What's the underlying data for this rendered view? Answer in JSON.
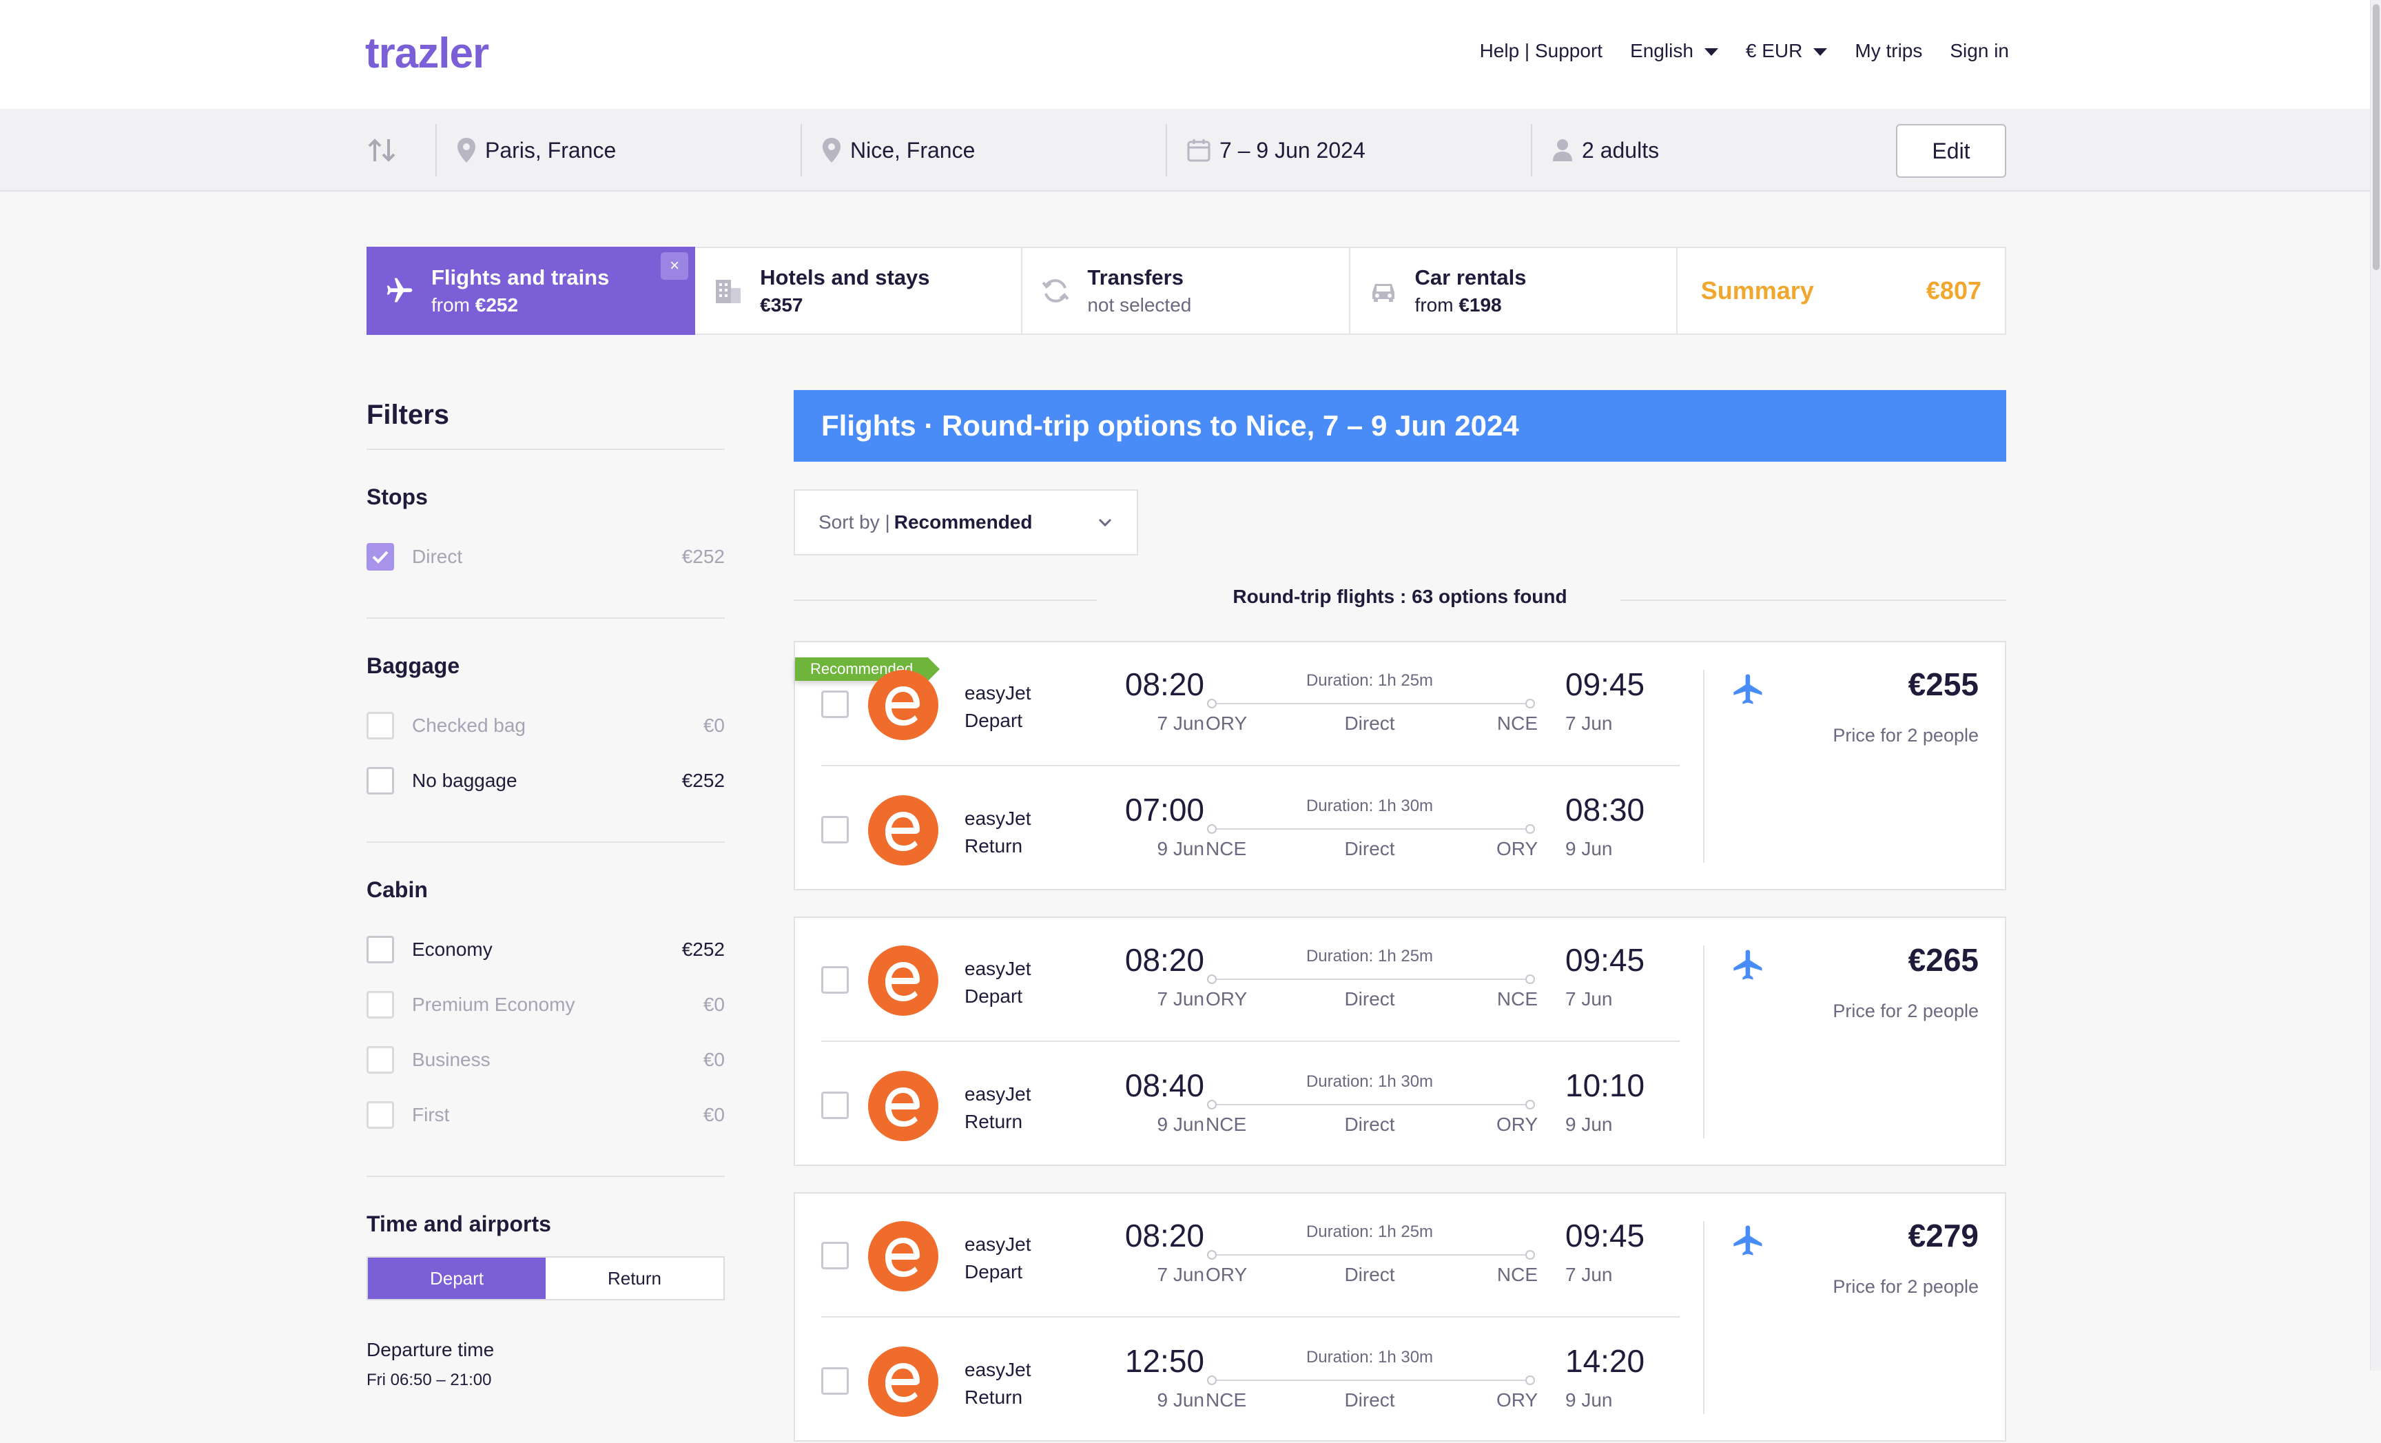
{
  "header": {
    "logo": "trazler",
    "nav": {
      "help": "Help | Support",
      "language": "English",
      "currency": "€ EUR",
      "my_trips": "My trips",
      "sign_in": "Sign in"
    }
  },
  "search": {
    "origin": "Paris, France",
    "destination": "Nice, France",
    "dates": "7 – 9 Jun 2024",
    "travelers": "2 adults",
    "edit": "Edit"
  },
  "tabs": {
    "flights": {
      "title": "Flights and trains",
      "sub_prefix": "from ",
      "sub_value": "€252"
    },
    "hotels": {
      "title": "Hotels and stays",
      "sub_value": "€357"
    },
    "transfers": {
      "title": "Transfers",
      "sub": "not selected"
    },
    "cars": {
      "title": "Car rentals",
      "sub_prefix": "from ",
      "sub_value": "€198"
    },
    "summary": {
      "label": "Summary",
      "value": "€807"
    },
    "close": "×"
  },
  "filters": {
    "title": "Filters",
    "stops": {
      "title": "Stops",
      "items": [
        {
          "label": "Direct",
          "value": "€252"
        }
      ]
    },
    "baggage": {
      "title": "Baggage",
      "items": [
        {
          "label": "Checked bag",
          "value": "€0"
        },
        {
          "label": "No baggage",
          "value": "€252"
        }
      ]
    },
    "cabin": {
      "title": "Cabin",
      "items": [
        {
          "label": "Economy",
          "value": "€252"
        },
        {
          "label": "Premium Economy",
          "value": "€0"
        },
        {
          "label": "Business",
          "value": "€0"
        },
        {
          "label": "First",
          "value": "€0"
        }
      ]
    },
    "time": {
      "title": "Time and airports",
      "depart": "Depart",
      "return": "Return",
      "departure_label": "Departure time",
      "departure_range": "Fri 06:50 – 21:00"
    }
  },
  "results": {
    "banner": "Flights · Round-trip options to Nice, 7 – 9 Jun 2024",
    "sort_prefix": "Sort by |",
    "sort_value": "Recommended",
    "found": "Round-trip flights : 63 options found",
    "recommended_badge": "Recommended",
    "cards": [
      {
        "price": "€255",
        "price_note": "Price for 2 people",
        "depart": {
          "airline": "easyJet",
          "direction": "Depart",
          "dep_time": "08:20",
          "dep_date": "7 Jun",
          "from": "ORY",
          "duration": "Duration: 1h 25m",
          "stops": "Direct",
          "to": "NCE",
          "arr_time": "09:45",
          "arr_date": "7 Jun"
        },
        "return": {
          "airline": "easyJet",
          "direction": "Return",
          "dep_time": "07:00",
          "dep_date": "9 Jun",
          "from": "NCE",
          "duration": "Duration: 1h 30m",
          "stops": "Direct",
          "to": "ORY",
          "arr_time": "08:30",
          "arr_date": "9 Jun"
        }
      },
      {
        "price": "€265",
        "price_note": "Price for 2 people",
        "depart": {
          "airline": "easyJet",
          "direction": "Depart",
          "dep_time": "08:20",
          "dep_date": "7 Jun",
          "from": "ORY",
          "duration": "Duration: 1h 25m",
          "stops": "Direct",
          "to": "NCE",
          "arr_time": "09:45",
          "arr_date": "7 Jun"
        },
        "return": {
          "airline": "easyJet",
          "direction": "Return",
          "dep_time": "08:40",
          "dep_date": "9 Jun",
          "from": "NCE",
          "duration": "Duration: 1h 30m",
          "stops": "Direct",
          "to": "ORY",
          "arr_time": "10:10",
          "arr_date": "9 Jun"
        }
      },
      {
        "price": "€279",
        "price_note": "Price for 2 people",
        "depart": {
          "airline": "easyJet",
          "direction": "Depart",
          "dep_time": "08:20",
          "dep_date": "7 Jun",
          "from": "ORY",
          "duration": "Duration: 1h 25m",
          "stops": "Direct",
          "to": "NCE",
          "arr_time": "09:45",
          "arr_date": "7 Jun"
        },
        "return": {
          "airline": "easyJet",
          "direction": "Return",
          "dep_time": "12:50",
          "dep_date": "9 Jun",
          "from": "NCE",
          "duration": "Duration: 1h 30m",
          "stops": "Direct",
          "to": "ORY",
          "arr_time": "14:20",
          "arr_date": "9 Jun"
        }
      }
    ]
  },
  "colors": {
    "brand": "#7b5fd6",
    "banner": "#4a8cf7",
    "summary": "#f0a72d",
    "airline": "#ef6c2c",
    "badge": "#6fb53c"
  },
  "icons": [
    "swap-icon",
    "location-pin-icon",
    "calendar-icon",
    "person-icon",
    "plane-icon",
    "building-icon",
    "sync-icon",
    "car-icon",
    "close-icon",
    "check-icon",
    "chevron-down-icon",
    "caret-down-icon",
    "easyjet-logo"
  ]
}
